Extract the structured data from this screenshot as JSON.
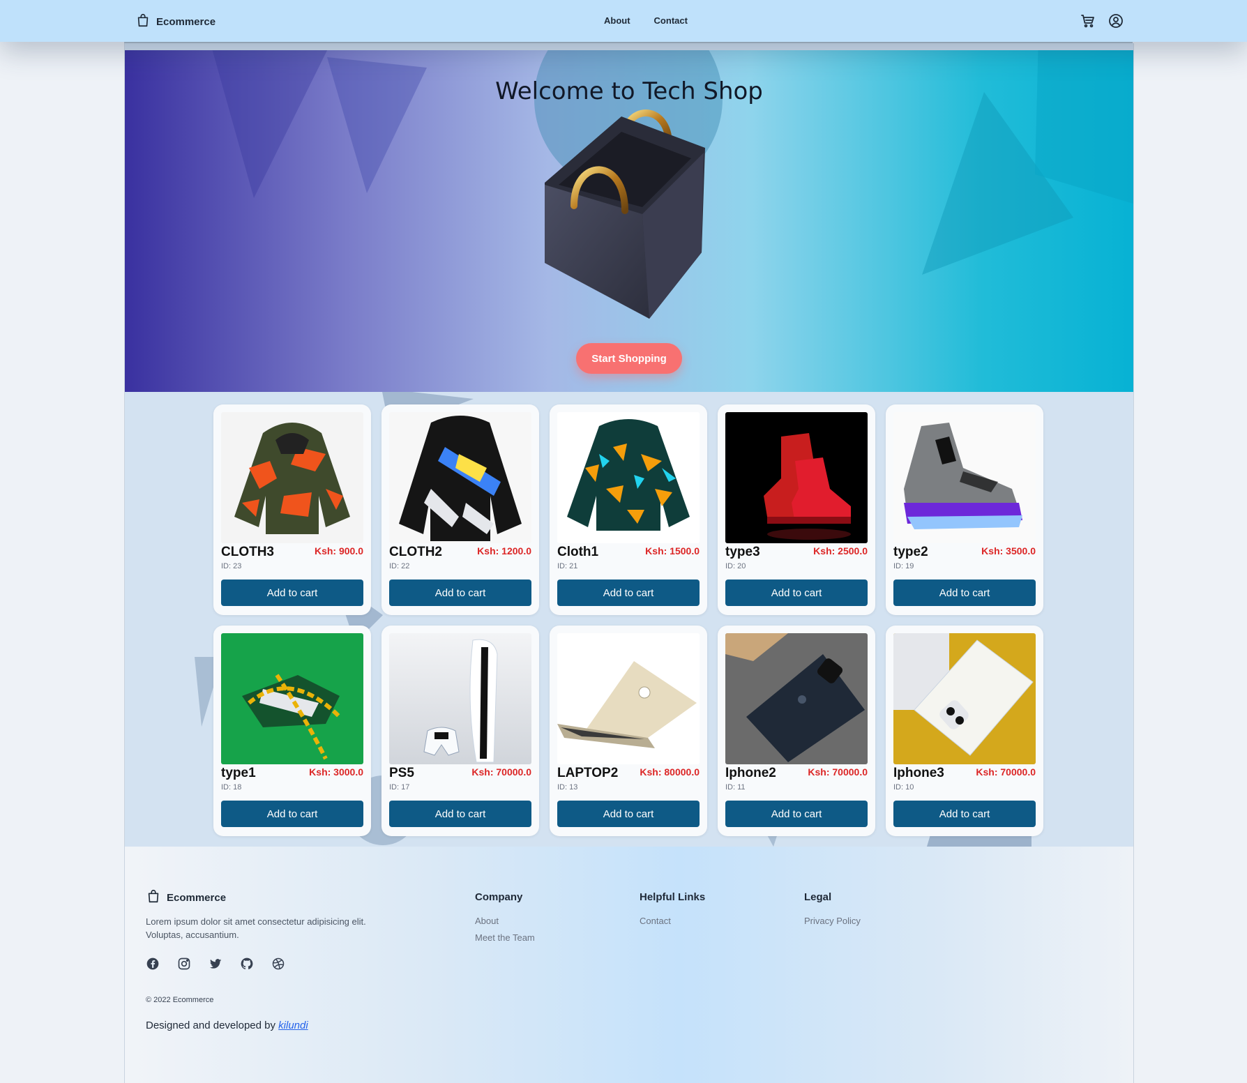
{
  "navbar": {
    "brand": "Ecommerce",
    "links": [
      "About",
      "Contact"
    ],
    "icons": [
      "cart-icon",
      "user-circle-icon"
    ],
    "bg_color": "#bfe1fb"
  },
  "hero": {
    "title": "Welcome to Tech Shop",
    "button_label": "Start Shopping",
    "button_color": "#f87171"
  },
  "products": [
    {
      "name": "CLOTH3",
      "price": "Ksh: 900.0",
      "id": "ID: 23",
      "button": "Add to cart",
      "image": "camo-puffer-jacket"
    },
    {
      "name": "CLOTH2",
      "price": "Ksh: 1200.0",
      "id": "ID: 22",
      "button": "Add to cart",
      "image": "black-graphic-jacket"
    },
    {
      "name": "Cloth1",
      "price": "Ksh: 1500.0",
      "id": "ID: 21",
      "button": "Add to cart",
      "image": "teal-pattern-jacket"
    },
    {
      "name": "type3",
      "price": "Ksh: 2500.0",
      "id": "ID: 20",
      "button": "Add to cart",
      "image": "red-sneakers"
    },
    {
      "name": "type2",
      "price": "Ksh: 3500.0",
      "id": "ID: 19",
      "button": "Add to cart",
      "image": "grey-purple-sneaker"
    },
    {
      "name": "type1",
      "price": "Ksh: 3000.0",
      "id": "ID: 18",
      "button": "Add to cart",
      "image": "chained-sneaker-green"
    },
    {
      "name": "PS5",
      "price": "Ksh: 70000.0",
      "id": "ID: 17",
      "button": "Add to cart",
      "image": "ps5-console"
    },
    {
      "name": "LAPTOP2",
      "price": "Ksh: 80000.0",
      "id": "ID: 13",
      "button": "Add to cart",
      "image": "gold-laptop"
    },
    {
      "name": "Iphone2",
      "price": "Ksh: 70000.0",
      "id": "ID: 11",
      "button": "Add to cart",
      "image": "black-iphone"
    },
    {
      "name": "Iphone3",
      "price": "Ksh: 70000.0",
      "id": "ID: 10",
      "button": "Add to cart",
      "image": "white-iphone"
    }
  ],
  "footer": {
    "brand": "Ecommerce",
    "description": "Lorem ipsum dolor sit amet consectetur adipisicing elit. Voluptas, accusantium.",
    "social_icons": [
      "facebook-icon",
      "instagram-icon",
      "twitter-icon",
      "github-icon",
      "dribbble-icon"
    ],
    "copyright": "© 2022 Ecommerce",
    "credit_prefix": "Designed and developed by ",
    "credit_link": "kilundi",
    "columns": [
      {
        "heading": "Company",
        "links": [
          "About",
          "Meet the Team"
        ]
      },
      {
        "heading": "Helpful Links",
        "links": [
          "Contact"
        ]
      },
      {
        "heading": "Legal",
        "links": [
          "Privacy Policy"
        ]
      }
    ]
  },
  "colors": {
    "accent_button": "#0e5a86",
    "price": "#dc2626"
  }
}
